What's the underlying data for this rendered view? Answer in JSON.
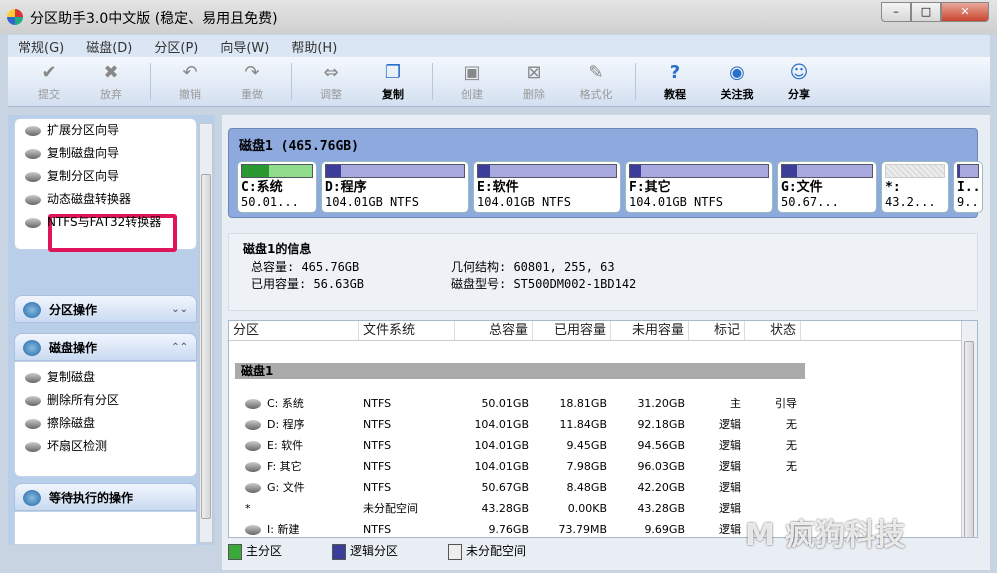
{
  "window": {
    "title": "分区助手3.0中文版 (稳定、易用且免费)",
    "controls": [
      "–",
      "□",
      "✕"
    ]
  },
  "menu": [
    "常规(G)",
    "磁盘(D)",
    "分区(P)",
    "向导(W)",
    "帮助(H)"
  ],
  "toolbar": [
    {
      "label": "提交",
      "icon": "✔",
      "enabled": false
    },
    {
      "label": "放弃",
      "icon": "✖",
      "enabled": false
    },
    {
      "sep": true
    },
    {
      "label": "撤销",
      "icon": "↶",
      "enabled": false
    },
    {
      "label": "重做",
      "icon": "↷",
      "enabled": false
    },
    {
      "sep": true
    },
    {
      "label": "调整",
      "icon": "⇔",
      "enabled": false
    },
    {
      "label": "复制",
      "icon": "❐",
      "enabled": true
    },
    {
      "sep": true
    },
    {
      "label": "创建",
      "icon": "▣",
      "enabled": false
    },
    {
      "label": "删除",
      "icon": "⊠",
      "enabled": false
    },
    {
      "label": "格式化",
      "icon": "✎",
      "enabled": false
    },
    {
      "sep": true
    },
    {
      "label": "教程",
      "icon": "?",
      "enabled": true
    },
    {
      "label": "关注我",
      "icon": "◉",
      "enabled": true
    },
    {
      "label": "分享",
      "icon": "☺",
      "enabled": true
    }
  ],
  "sidebar": {
    "wizards": [
      "扩展分区向导",
      "复制磁盘向导",
      "复制分区向导",
      "动态磁盘转换器",
      "NTFS与FAT32转换器"
    ],
    "partition_ops": {
      "title": "分区操作"
    },
    "disk_ops": {
      "title": "磁盘操作",
      "items": [
        "复制磁盘",
        "删除所有分区",
        "擦除磁盘",
        "坏扇区检测"
      ]
    },
    "pending": {
      "title": "等待执行的操作"
    }
  },
  "disk_map": {
    "title": "磁盘1 (465.76GB)",
    "partitions": [
      {
        "name": "C:系统",
        "detail": "50.01...",
        "type": "primary",
        "used": 0.38
      },
      {
        "name": "D:程序",
        "detail": "104.01GB NTFS",
        "type": "logical",
        "used": 0.11
      },
      {
        "name": "E:软件",
        "detail": "104.01GB NTFS",
        "type": "logical",
        "used": 0.09
      },
      {
        "name": "F:其它",
        "detail": "104.01GB NTFS",
        "type": "logical",
        "used": 0.08
      },
      {
        "name": "G:文件",
        "detail": "50.67...",
        "type": "logical",
        "used": 0.17
      },
      {
        "name": "*:",
        "detail": "43.2...",
        "type": "unallocated",
        "used": 0
      },
      {
        "name": "I..",
        "detail": "9..",
        "type": "logical",
        "used": 0.01
      }
    ]
  },
  "disk_info": {
    "title": "磁盘1的信息",
    "total": "总容量: 465.76GB",
    "used": "已用容量: 56.63GB",
    "geometry": "几何结构: 60801, 255, 63",
    "model": "磁盘型号: ST500DM002-1BD142"
  },
  "table": {
    "columns": [
      "分区",
      "文件系统",
      "总容量",
      "已用容量",
      "未用容量",
      "标记",
      "状态"
    ],
    "group": "磁盘1",
    "rows": [
      [
        "C: 系统",
        "NTFS",
        "50.01GB",
        "18.81GB",
        "31.20GB",
        "主",
        "引导"
      ],
      [
        "D: 程序",
        "NTFS",
        "104.01GB",
        "11.84GB",
        "92.18GB",
        "逻辑",
        "无"
      ],
      [
        "E: 软件",
        "NTFS",
        "104.01GB",
        "9.45GB",
        "94.56GB",
        "逻辑",
        "无"
      ],
      [
        "F: 其它",
        "NTFS",
        "104.01GB",
        "7.98GB",
        "96.03GB",
        "逻辑",
        "无"
      ],
      [
        "G: 文件",
        "NTFS",
        "50.67GB",
        "8.48GB",
        "42.20GB",
        "逻辑",
        ""
      ],
      [
        "*",
        "未分配空间",
        "43.28GB",
        "0.00KB",
        "43.28GB",
        "逻辑",
        ""
      ],
      [
        "I: 新建",
        "NTFS",
        "9.76GB",
        "73.79MB",
        "9.69GB",
        "逻辑",
        ""
      ]
    ]
  },
  "legend": [
    {
      "label": "主分区",
      "color": "#3aa83a"
    },
    {
      "label": "逻辑分区",
      "color": "#3b3f9a"
    },
    {
      "label": "未分配空间",
      "color": "#eeeeee"
    }
  ],
  "watermark": "M 疯狗科技"
}
